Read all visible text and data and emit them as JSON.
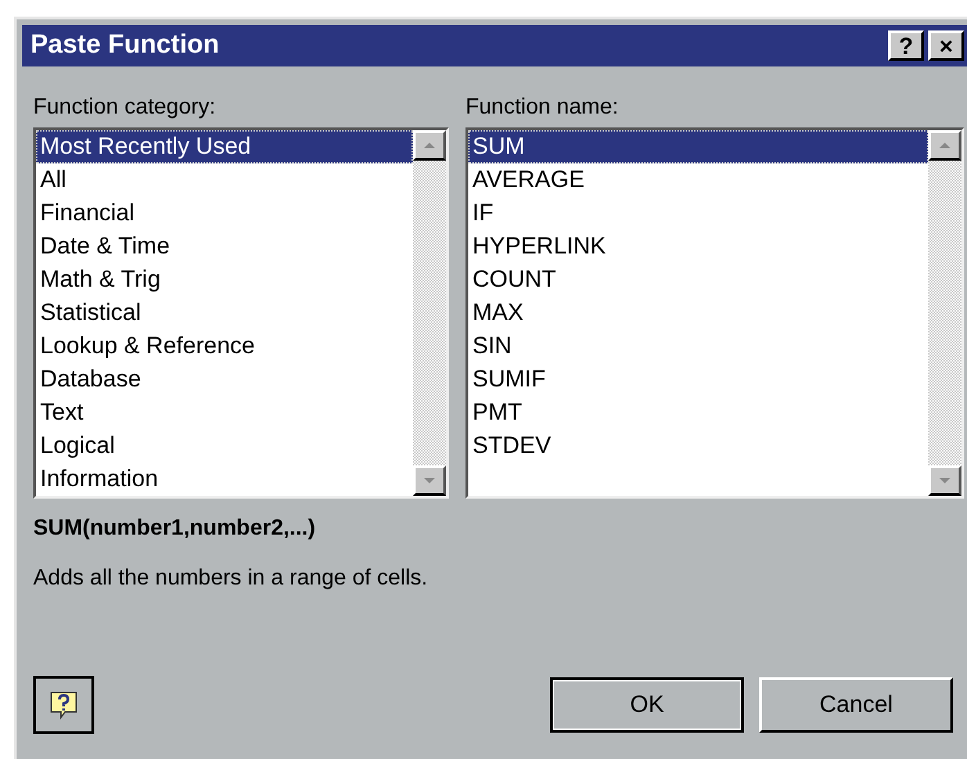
{
  "window": {
    "title": "Paste Function",
    "title_buttons": [
      "?",
      "×"
    ]
  },
  "category": {
    "label": "Function category:",
    "items": [
      {
        "label": "Most Recently Used",
        "selected": true
      },
      {
        "label": "All",
        "selected": false
      },
      {
        "label": "Financial",
        "selected": false
      },
      {
        "label": "Date & Time",
        "selected": false
      },
      {
        "label": "Math & Trig",
        "selected": false
      },
      {
        "label": "Statistical",
        "selected": false
      },
      {
        "label": "Lookup & Reference",
        "selected": false
      },
      {
        "label": "Database",
        "selected": false
      },
      {
        "label": "Text",
        "selected": false
      },
      {
        "label": "Logical",
        "selected": false
      },
      {
        "label": "Information",
        "selected": false
      }
    ]
  },
  "function_name": {
    "label": "Function name:",
    "items": [
      {
        "label": "SUM",
        "selected": true
      },
      {
        "label": "AVERAGE",
        "selected": false
      },
      {
        "label": "IF",
        "selected": false
      },
      {
        "label": "HYPERLINK",
        "selected": false
      },
      {
        "label": "COUNT",
        "selected": false
      },
      {
        "label": "MAX",
        "selected": false
      },
      {
        "label": "SIN",
        "selected": false
      },
      {
        "label": "SUMIF",
        "selected": false
      },
      {
        "label": "PMT",
        "selected": false
      },
      {
        "label": "STDEV",
        "selected": false
      }
    ]
  },
  "signature": "SUM(number1,number2,...)",
  "description": "Adds all the numbers in a range of cells.",
  "buttons": [
    "OK",
    "Cancel"
  ]
}
